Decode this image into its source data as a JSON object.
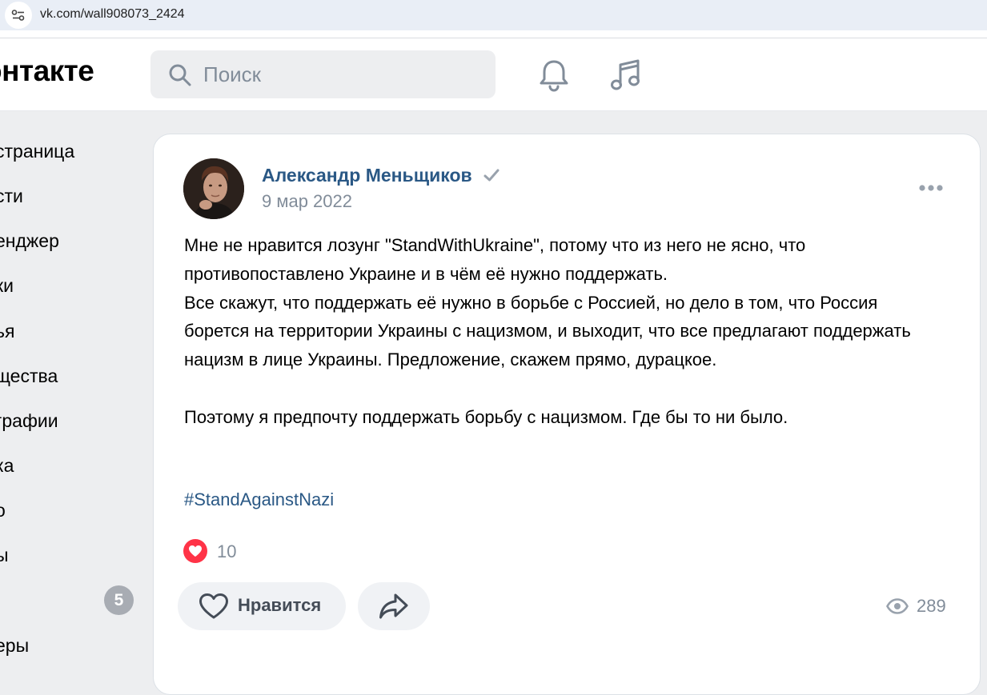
{
  "browser": {
    "url": "vk.com/wall908073_2424"
  },
  "header": {
    "logo_text": "онтакте",
    "search_placeholder": "Поиск",
    "icons": [
      "bell-icon",
      "music-note-icon"
    ]
  },
  "sidebar": {
    "items": [
      {
        "label": "страница"
      },
      {
        "label": "сти"
      },
      {
        "label": "енджер"
      },
      {
        "label": "ки"
      },
      {
        "label": "ья"
      },
      {
        "label": "щества"
      },
      {
        "label": "графии"
      },
      {
        "label": "ка"
      },
      {
        "label": "о"
      },
      {
        "label": "ы"
      },
      {
        "label": "еры"
      }
    ],
    "badge": "5"
  },
  "post": {
    "author": "Александр Меньщиков",
    "verified": true,
    "date": "9 мар 2022",
    "paragraphs": [
      "Мне не нравится лозунг \"StandWithUkraine\", потому что из него не ясно, что противопоставлено Украине и в чём её нужно поддержать.",
      "Все скажут, что поддержать её нужно в борьбе с Россией, но дело в том, что Россия борется на территории Украины с нацизмом, и выходит, что все предлагают поддержать нацизм в лице Украины. Предложение, скажем прямо, дурацкое.",
      "Поэтому я предпочту поддержать борьбу с нацизмом. Где бы то ни было."
    ],
    "hashtag": "#StandAgainstNazi",
    "reactions_count": "10",
    "like_label": "Нравится",
    "views": "289"
  },
  "colors": {
    "link": "#2a5885",
    "secondary_text": "#818c99",
    "reaction_red": "#ff3347",
    "page_bg": "#edeef0"
  }
}
